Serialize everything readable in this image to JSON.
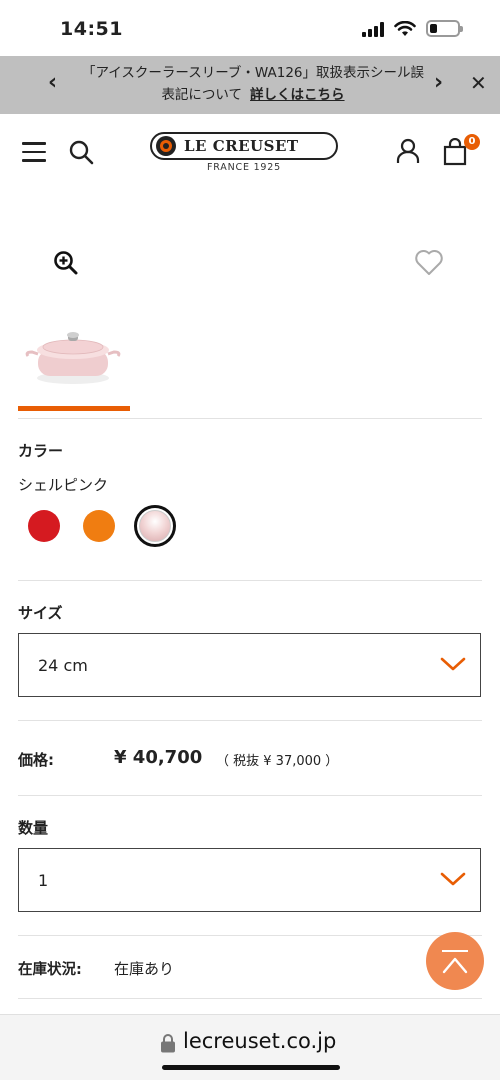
{
  "status_bar": {
    "time": "14:51",
    "battery_level": 0.25
  },
  "banner": {
    "message": "「アイスクーラースリーブ・WA126」取扱表示シール誤表記について",
    "link_label": "詳しくはこちら",
    "prev_icon": "chevron-left-icon",
    "next_icon": "chevron-right-icon",
    "close_icon": "close-icon"
  },
  "header": {
    "brand": "LE CREUSET",
    "brand_sub": "FRANCE 1925",
    "cart_count": "0",
    "icons": [
      "menu-icon",
      "search-icon",
      "account-icon",
      "cart-icon"
    ]
  },
  "gallery": {
    "zoom_icon": "zoom-in-icon",
    "wishlist_icon": "heart-icon"
  },
  "color": {
    "label": "カラー",
    "selected_name": "シェルピンク",
    "swatches": [
      {
        "name": "red",
        "hex": "#d51a20"
      },
      {
        "name": "orange",
        "hex": "#f07d11"
      },
      {
        "name": "shell-pink",
        "hex": "#f0d4d4",
        "selected": true
      }
    ]
  },
  "size": {
    "label": "サイズ",
    "selected": "24 cm"
  },
  "price": {
    "label": "価格:",
    "value": "¥ 40,700",
    "tax_note": "（ 税抜 ¥ 37,000 ）"
  },
  "quantity": {
    "label": "数量",
    "selected": "1"
  },
  "stock": {
    "label": "在庫状況:",
    "value": "在庫あり"
  },
  "browser": {
    "url": "lecreuset.co.jp"
  },
  "colors": {
    "accent": "#e85d04",
    "banner_bg": "#bfbfbf"
  }
}
